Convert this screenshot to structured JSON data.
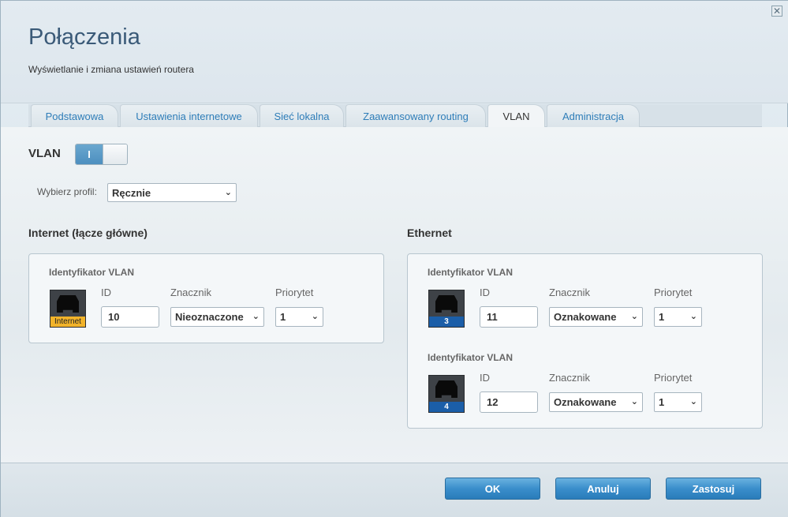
{
  "header": {
    "title": "Połączenia",
    "subtitle": "Wyświetlanie i zmiana ustawień routera",
    "close_icon": "close-icon"
  },
  "tabs": [
    {
      "label": "Podstawowa",
      "active": false
    },
    {
      "label": "Ustawienia internetowe",
      "active": false
    },
    {
      "label": "Sieć lokalna",
      "active": false
    },
    {
      "label": "Zaawansowany routing",
      "active": false
    },
    {
      "label": "VLAN",
      "active": true
    },
    {
      "label": "Administracja",
      "active": false
    }
  ],
  "vlan": {
    "label": "VLAN",
    "toggle_on_text": "I",
    "enabled": true,
    "profile_label": "Wybierz profil:",
    "profile_value": "Ręcznie"
  },
  "internet": {
    "section_title": "Internet (łącze główne)",
    "panel_title": "Identyfikator VLAN",
    "id_label": "ID",
    "tag_label": "Znacznik",
    "priority_label": "Priorytet",
    "port_label": "Internet",
    "id_value": "10",
    "tag_value": "Nieoznaczone",
    "priority_value": "1"
  },
  "ethernet": {
    "section_title": "Ethernet",
    "entries": [
      {
        "panel_title": "Identyfikator VLAN",
        "id_label": "ID",
        "tag_label": "Znacznik",
        "priority_label": "Priorytet",
        "port_number": "3",
        "id_value": "11",
        "tag_value": "Oznakowane",
        "priority_value": "1"
      },
      {
        "panel_title": "Identyfikator VLAN",
        "id_label": "ID",
        "tag_label": "Znacznik",
        "priority_label": "Priorytet",
        "port_number": "4",
        "id_value": "12",
        "tag_value": "Oznakowane",
        "priority_value": "1"
      }
    ]
  },
  "footer": {
    "ok_label": "OK",
    "cancel_label": "Anuluj",
    "apply_label": "Zastosuj"
  },
  "colors": {
    "accent": "#2e7db8",
    "button": "#3a8ecb",
    "internet_tag": "#f2b32a",
    "port_tag": "#1b5ea8"
  }
}
